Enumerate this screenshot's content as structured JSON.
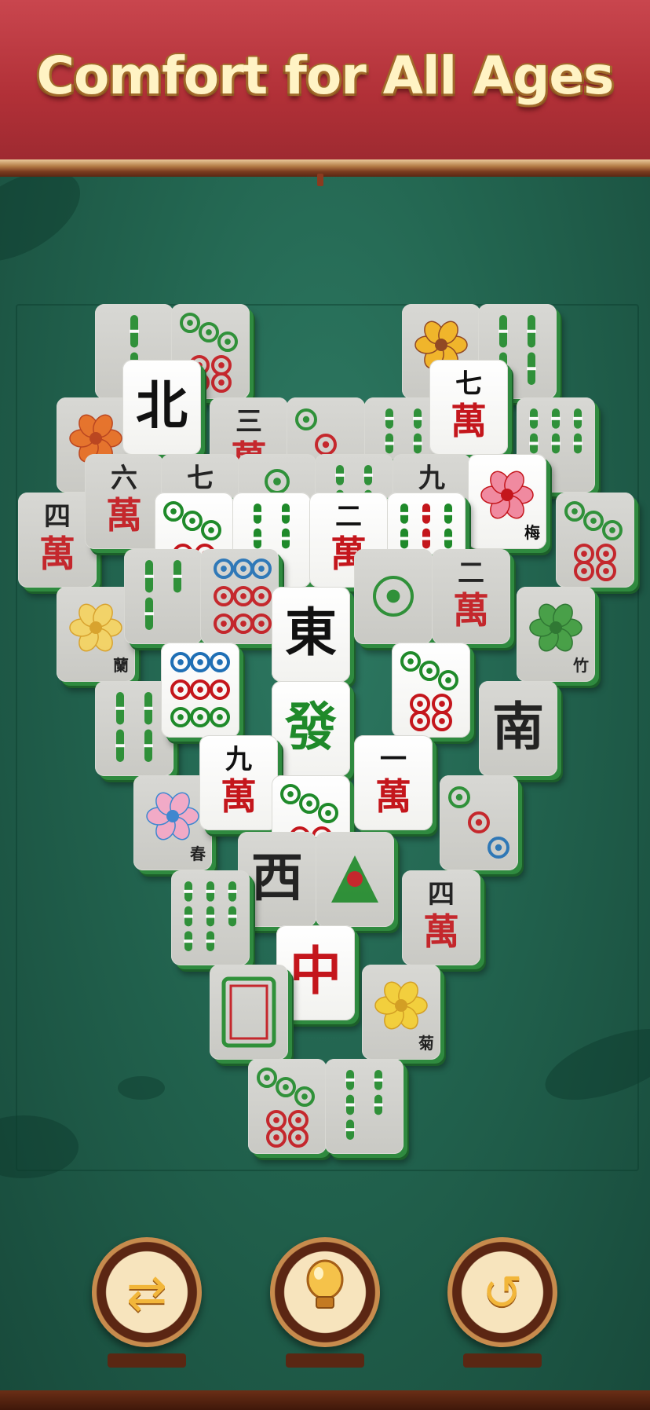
{
  "banner": {
    "title": "Comfort for All Ages"
  },
  "board": {
    "tiles": [
      {
        "id": "t01",
        "kind": "bamboo",
        "n": 2,
        "dim": true
      },
      {
        "id": "t02",
        "kind": "dots",
        "n": 5,
        "dim": true
      },
      {
        "id": "t03",
        "kind": "flower",
        "flower": "sunflower",
        "dim": true
      },
      {
        "id": "t04",
        "kind": "bamboo",
        "n": 4,
        "dim": true
      },
      {
        "id": "t05",
        "kind": "flower",
        "flower": "maple",
        "dim": true
      },
      {
        "id": "t06",
        "kind": "char",
        "text": "北",
        "color": "#111111",
        "dim": false
      },
      {
        "id": "t07",
        "kind": "wan",
        "top": "三",
        "bot": "萬",
        "dim": true
      },
      {
        "id": "t08",
        "kind": "dots",
        "n": 3,
        "dim": true
      },
      {
        "id": "t09",
        "kind": "bamboo",
        "n": 6,
        "dim": true
      },
      {
        "id": "t10",
        "kind": "wan",
        "top": "七",
        "bot": "萬",
        "dim": false
      },
      {
        "id": "t11",
        "kind": "bamboo",
        "n": 7,
        "dim": true
      },
      {
        "id": "t12",
        "kind": "wan",
        "top": "四",
        "bot": "萬",
        "dim": true
      },
      {
        "id": "t13",
        "kind": "wan",
        "top": "六",
        "bot": "萬",
        "dim": true
      },
      {
        "id": "t14",
        "kind": "wan",
        "top": "七",
        "bot": "萬",
        "dim": true
      },
      {
        "id": "t15",
        "kind": "dots",
        "n": 2,
        "dim": true
      },
      {
        "id": "t16",
        "kind": "bamboo",
        "n": 6,
        "dim": true
      },
      {
        "id": "t17",
        "kind": "wan",
        "top": "九",
        "bot": "萬",
        "dim": true
      },
      {
        "id": "t18",
        "kind": "flower",
        "flower": "plum",
        "label": "梅",
        "dim": false
      },
      {
        "id": "t19",
        "kind": "dots",
        "n": 5,
        "dim": true
      },
      {
        "id": "t20",
        "kind": "dots",
        "n": 5,
        "dim": false
      },
      {
        "id": "t21",
        "kind": "bamboo",
        "n": 5,
        "dim": false
      },
      {
        "id": "t22",
        "kind": "wan",
        "top": "二",
        "bot": "萬",
        "dim": false
      },
      {
        "id": "t23",
        "kind": "bamboo",
        "n": 9,
        "dim": false
      },
      {
        "id": "t24",
        "kind": "flower",
        "flower": "orchid",
        "label": "蘭",
        "dim": true
      },
      {
        "id": "t25",
        "kind": "bamboo",
        "n": 3,
        "dim": true
      },
      {
        "id": "t26",
        "kind": "dots",
        "n": 6,
        "dim": true
      },
      {
        "id": "t27",
        "kind": "char",
        "text": "東",
        "color": "#111111",
        "dim": false
      },
      {
        "id": "t28",
        "kind": "dots",
        "n": 1,
        "dim": true
      },
      {
        "id": "t29",
        "kind": "wan",
        "top": "二",
        "bot": "萬",
        "dim": true
      },
      {
        "id": "t30",
        "kind": "flower",
        "flower": "bamboo",
        "label": "竹",
        "dim": true
      },
      {
        "id": "t31",
        "kind": "bamboo",
        "n": 4,
        "dim": true
      },
      {
        "id": "t32",
        "kind": "dots",
        "n": 9,
        "dim": false
      },
      {
        "id": "t33",
        "kind": "char",
        "text": "發",
        "color": "#1f8a2a",
        "dim": false
      },
      {
        "id": "t34",
        "kind": "dots",
        "n": 5,
        "dim": false
      },
      {
        "id": "t35",
        "kind": "char",
        "text": "南",
        "color": "#111111",
        "dim": true
      },
      {
        "id": "t36",
        "kind": "flower",
        "flower": "spring",
        "label": "春",
        "dim": true
      },
      {
        "id": "t37",
        "kind": "wan",
        "top": "九",
        "bot": "萬",
        "dim": false
      },
      {
        "id": "t38",
        "kind": "dots",
        "n": 5,
        "dim": false
      },
      {
        "id": "t39",
        "kind": "wan",
        "top": "一",
        "bot": "萬",
        "dim": false
      },
      {
        "id": "t40",
        "kind": "dots",
        "n": 3,
        "dim": true
      },
      {
        "id": "t41",
        "kind": "char",
        "text": "西",
        "color": "#111111",
        "dim": true
      },
      {
        "id": "t42",
        "kind": "bird",
        "dim": true
      },
      {
        "id": "t43",
        "kind": "bamboo",
        "n": 8,
        "dim": true
      },
      {
        "id": "t44",
        "kind": "wan",
        "top": "四",
        "bot": "萬",
        "dim": true
      },
      {
        "id": "t45",
        "kind": "char",
        "text": "中",
        "color": "#c4161c",
        "dim": false
      },
      {
        "id": "t46",
        "kind": "white",
        "dim": true
      },
      {
        "id": "t47",
        "kind": "flower",
        "flower": "chrysanthemum",
        "label": "菊",
        "dim": true
      },
      {
        "id": "t48",
        "kind": "dots",
        "n": 5,
        "dim": true
      },
      {
        "id": "t49",
        "kind": "bamboo",
        "n": 5,
        "dim": true
      }
    ]
  },
  "controls": [
    {
      "name": "shuffle-button",
      "icon": "shuffle-icon",
      "glyph": "⇄"
    },
    {
      "name": "hint-button",
      "icon": "lightbulb-icon",
      "glyph": "💡"
    },
    {
      "name": "undo-button",
      "icon": "undo-icon",
      "glyph": "↺"
    }
  ],
  "colors": {
    "banner_red": "#b13037",
    "felt_green": "#22644f",
    "title_cream": "#fff3c4",
    "tile_edge": "#2f8a3f",
    "wan_red": "#c4161c",
    "bamboo_green": "#1f8a2a",
    "dot_blue": "#1f6fb5"
  }
}
